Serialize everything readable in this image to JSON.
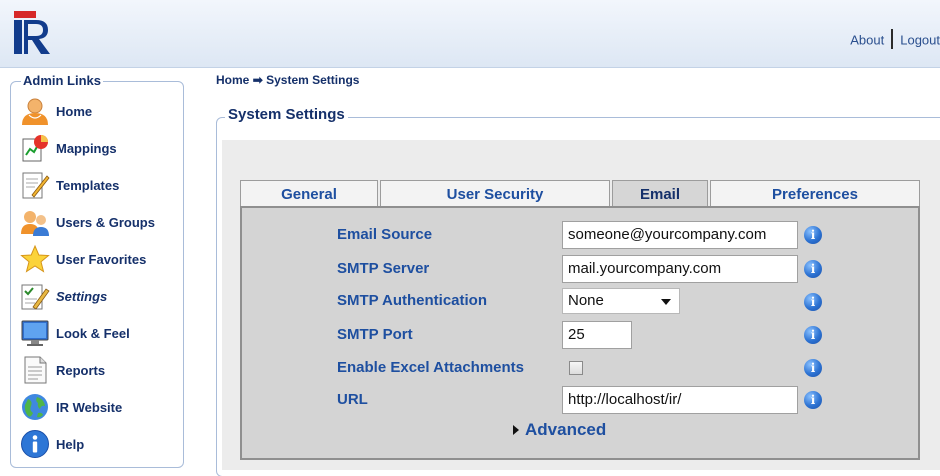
{
  "header": {
    "about_label": "About",
    "logout_label": "Logout"
  },
  "sidebar": {
    "title": "Admin Links",
    "items": [
      {
        "label": "Home",
        "icon": "user-icon"
      },
      {
        "label": "Mappings",
        "icon": "mappings-icon"
      },
      {
        "label": "Templates",
        "icon": "templates-icon"
      },
      {
        "label": "Users & Groups",
        "icon": "users-groups-icon"
      },
      {
        "label": "User Favorites",
        "icon": "star-icon"
      },
      {
        "label": "Settings",
        "icon": "settings-icon",
        "active": true
      },
      {
        "label": "Look & Feel",
        "icon": "monitor-icon"
      },
      {
        "label": "Reports",
        "icon": "report-icon"
      },
      {
        "label": "IR Website",
        "icon": "globe-icon"
      },
      {
        "label": "Help",
        "icon": "info-icon"
      }
    ]
  },
  "breadcrumb": {
    "home": "Home",
    "arrow": "➡",
    "current": "System Settings"
  },
  "settings": {
    "title": "System Settings",
    "tabs": [
      "General",
      "User Security",
      "Email",
      "Preferences"
    ],
    "active_tab": "Email",
    "fields": {
      "email_source": {
        "label": "Email Source",
        "value": "someone@yourcompany.com"
      },
      "smtp_server": {
        "label": "SMTP Server",
        "value": "mail.yourcompany.com"
      },
      "smtp_auth": {
        "label": "SMTP Authentication",
        "value": "None"
      },
      "smtp_port": {
        "label": "SMTP Port",
        "value": "25"
      },
      "excel_attachments": {
        "label": "Enable Excel Attachments",
        "checked": false
      },
      "url": {
        "label": "URL",
        "value": "http://localhost/ir/"
      }
    },
    "advanced_label": "Advanced"
  },
  "colors": {
    "link": "#1e4fa0",
    "header_bg": "#dde7f4",
    "panel_bg": "#d4d4d4"
  }
}
